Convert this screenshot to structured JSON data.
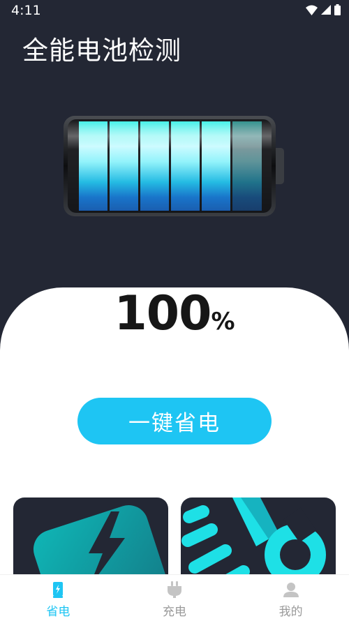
{
  "status": {
    "time": "4:11"
  },
  "app": {
    "title": "全能电池检测"
  },
  "battery": {
    "level_percent": 100,
    "bar_colors": [
      "#2fe3e0",
      "#1aa6d8",
      "#1c6fc7"
    ]
  },
  "percent": {
    "value": "100",
    "unit": "%"
  },
  "actions": {
    "save_label": "一键省电"
  },
  "cards": [
    {
      "icon": "battery-bolt-icon"
    },
    {
      "icon": "wrench-icon"
    }
  ],
  "nav": {
    "items": [
      {
        "label": "省电",
        "icon": "battery-save-icon",
        "active": true
      },
      {
        "label": "充电",
        "icon": "plug-icon",
        "active": false
      },
      {
        "label": "我的",
        "icon": "user-icon",
        "active": false
      }
    ]
  },
  "colors": {
    "accent": "#1ec5f3",
    "dark_bg": "#232734",
    "inactive": "#9a9a9a"
  }
}
